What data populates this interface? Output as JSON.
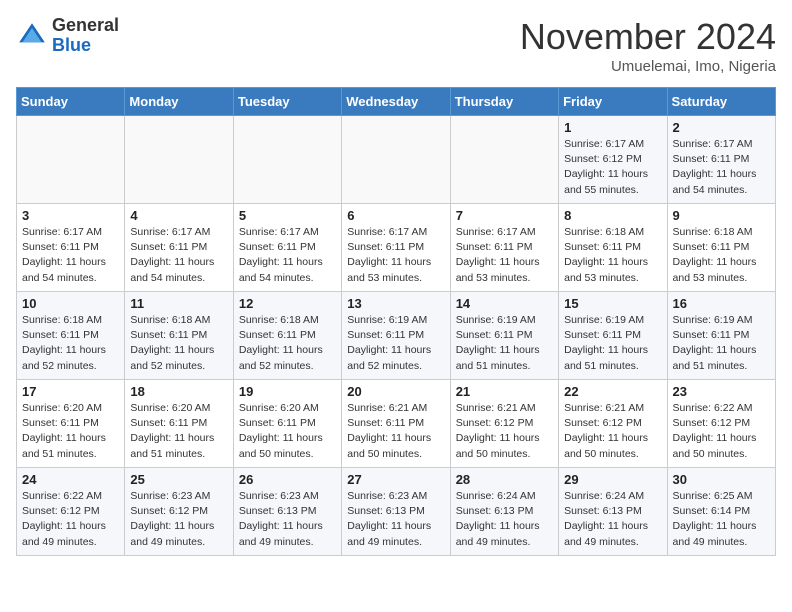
{
  "header": {
    "logo_general": "General",
    "logo_blue": "Blue",
    "month_title": "November 2024",
    "location": "Umuelemai, Imo, Nigeria"
  },
  "days_of_week": [
    "Sunday",
    "Monday",
    "Tuesday",
    "Wednesday",
    "Thursday",
    "Friday",
    "Saturday"
  ],
  "weeks": [
    [
      {
        "day": "",
        "info": ""
      },
      {
        "day": "",
        "info": ""
      },
      {
        "day": "",
        "info": ""
      },
      {
        "day": "",
        "info": ""
      },
      {
        "day": "",
        "info": ""
      },
      {
        "day": "1",
        "info": "Sunrise: 6:17 AM\nSunset: 6:12 PM\nDaylight: 11 hours and 55 minutes."
      },
      {
        "day": "2",
        "info": "Sunrise: 6:17 AM\nSunset: 6:11 PM\nDaylight: 11 hours and 54 minutes."
      }
    ],
    [
      {
        "day": "3",
        "info": "Sunrise: 6:17 AM\nSunset: 6:11 PM\nDaylight: 11 hours and 54 minutes."
      },
      {
        "day": "4",
        "info": "Sunrise: 6:17 AM\nSunset: 6:11 PM\nDaylight: 11 hours and 54 minutes."
      },
      {
        "day": "5",
        "info": "Sunrise: 6:17 AM\nSunset: 6:11 PM\nDaylight: 11 hours and 54 minutes."
      },
      {
        "day": "6",
        "info": "Sunrise: 6:17 AM\nSunset: 6:11 PM\nDaylight: 11 hours and 53 minutes."
      },
      {
        "day": "7",
        "info": "Sunrise: 6:17 AM\nSunset: 6:11 PM\nDaylight: 11 hours and 53 minutes."
      },
      {
        "day": "8",
        "info": "Sunrise: 6:18 AM\nSunset: 6:11 PM\nDaylight: 11 hours and 53 minutes."
      },
      {
        "day": "9",
        "info": "Sunrise: 6:18 AM\nSunset: 6:11 PM\nDaylight: 11 hours and 53 minutes."
      }
    ],
    [
      {
        "day": "10",
        "info": "Sunrise: 6:18 AM\nSunset: 6:11 PM\nDaylight: 11 hours and 52 minutes."
      },
      {
        "day": "11",
        "info": "Sunrise: 6:18 AM\nSunset: 6:11 PM\nDaylight: 11 hours and 52 minutes."
      },
      {
        "day": "12",
        "info": "Sunrise: 6:18 AM\nSunset: 6:11 PM\nDaylight: 11 hours and 52 minutes."
      },
      {
        "day": "13",
        "info": "Sunrise: 6:19 AM\nSunset: 6:11 PM\nDaylight: 11 hours and 52 minutes."
      },
      {
        "day": "14",
        "info": "Sunrise: 6:19 AM\nSunset: 6:11 PM\nDaylight: 11 hours and 51 minutes."
      },
      {
        "day": "15",
        "info": "Sunrise: 6:19 AM\nSunset: 6:11 PM\nDaylight: 11 hours and 51 minutes."
      },
      {
        "day": "16",
        "info": "Sunrise: 6:19 AM\nSunset: 6:11 PM\nDaylight: 11 hours and 51 minutes."
      }
    ],
    [
      {
        "day": "17",
        "info": "Sunrise: 6:20 AM\nSunset: 6:11 PM\nDaylight: 11 hours and 51 minutes."
      },
      {
        "day": "18",
        "info": "Sunrise: 6:20 AM\nSunset: 6:11 PM\nDaylight: 11 hours and 51 minutes."
      },
      {
        "day": "19",
        "info": "Sunrise: 6:20 AM\nSunset: 6:11 PM\nDaylight: 11 hours and 50 minutes."
      },
      {
        "day": "20",
        "info": "Sunrise: 6:21 AM\nSunset: 6:11 PM\nDaylight: 11 hours and 50 minutes."
      },
      {
        "day": "21",
        "info": "Sunrise: 6:21 AM\nSunset: 6:12 PM\nDaylight: 11 hours and 50 minutes."
      },
      {
        "day": "22",
        "info": "Sunrise: 6:21 AM\nSunset: 6:12 PM\nDaylight: 11 hours and 50 minutes."
      },
      {
        "day": "23",
        "info": "Sunrise: 6:22 AM\nSunset: 6:12 PM\nDaylight: 11 hours and 50 minutes."
      }
    ],
    [
      {
        "day": "24",
        "info": "Sunrise: 6:22 AM\nSunset: 6:12 PM\nDaylight: 11 hours and 49 minutes."
      },
      {
        "day": "25",
        "info": "Sunrise: 6:23 AM\nSunset: 6:12 PM\nDaylight: 11 hours and 49 minutes."
      },
      {
        "day": "26",
        "info": "Sunrise: 6:23 AM\nSunset: 6:13 PM\nDaylight: 11 hours and 49 minutes."
      },
      {
        "day": "27",
        "info": "Sunrise: 6:23 AM\nSunset: 6:13 PM\nDaylight: 11 hours and 49 minutes."
      },
      {
        "day": "28",
        "info": "Sunrise: 6:24 AM\nSunset: 6:13 PM\nDaylight: 11 hours and 49 minutes."
      },
      {
        "day": "29",
        "info": "Sunrise: 6:24 AM\nSunset: 6:13 PM\nDaylight: 11 hours and 49 minutes."
      },
      {
        "day": "30",
        "info": "Sunrise: 6:25 AM\nSunset: 6:14 PM\nDaylight: 11 hours and 49 minutes."
      }
    ]
  ]
}
